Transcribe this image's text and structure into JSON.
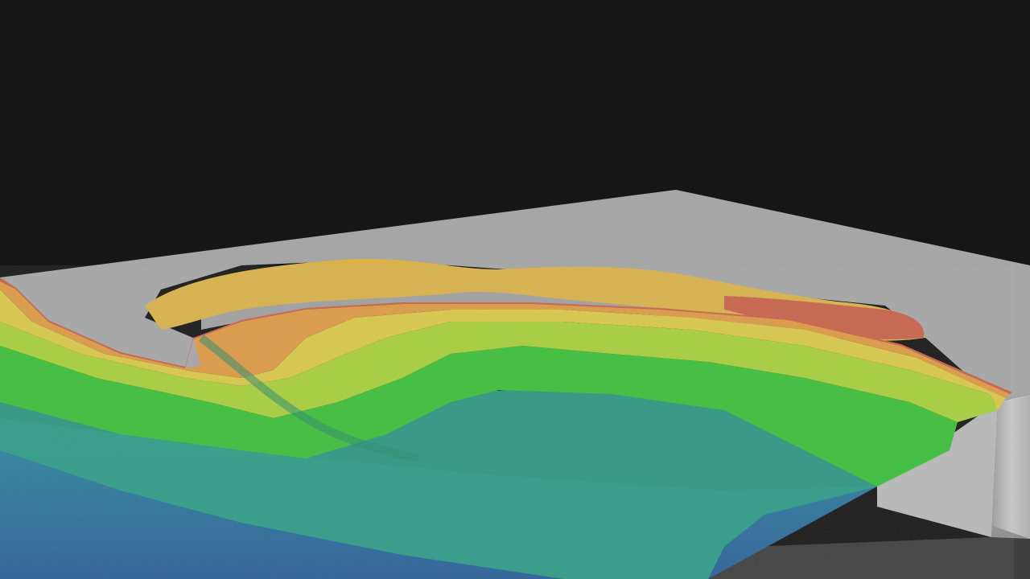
{
  "scene": {
    "kind": "3d-bathymetry-render",
    "colors": {
      "background": "#161616",
      "land": "#a6a6a6",
      "land_edge": "#8e8e8e",
      "block_side": "#bcbcbc",
      "block_side_dark": "#4e4e4e",
      "depth_red": "#c8624a",
      "depth_orange": "#dd9a45",
      "depth_yellow": "#d9c84a",
      "depth_yellowgreen": "#a8cf3c",
      "depth_green": "#3cbf3a",
      "depth_teal": "#2e9e86",
      "depth_blue": "#2f7fa2",
      "depth_deepblue": "#2a5f98"
    }
  }
}
